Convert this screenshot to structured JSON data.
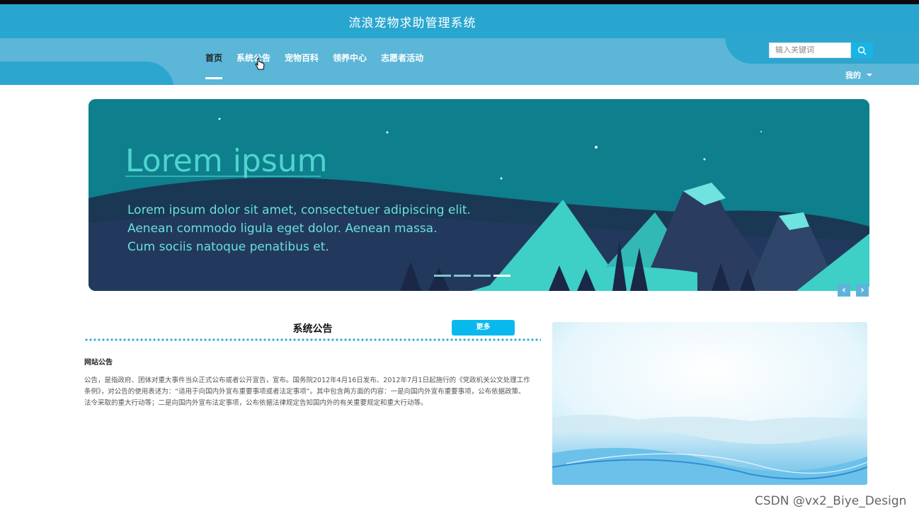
{
  "header": {
    "title": "流浪宠物求助管理系统",
    "search_placeholder": "输入关键词",
    "mine_label": "我的"
  },
  "nav": {
    "items": [
      {
        "label": "首页",
        "active": true
      },
      {
        "label": "系统公告"
      },
      {
        "label": "宠物百科"
      },
      {
        "label": "领养中心"
      },
      {
        "label": "志愿者活动"
      }
    ]
  },
  "banner": {
    "headline": "Lorem ipsum",
    "lines": [
      "Lorem ipsum dolor sit amet, consectetuer adipiscing elit.",
      "Aenean commodo ligula eget dolor. Aenean massa.",
      "Cum sociis natoque penatibus et."
    ],
    "slide_count": 4,
    "active_slide": 4,
    "colors": {
      "bg": "#0e7f8c",
      "mountain": "#3ecfc7",
      "dark": "#1c2b4a"
    }
  },
  "notice": {
    "section_title": "系统公告",
    "more_label": "更多",
    "item_title": "网站公告",
    "item_body": "公告，是指政府、团体对重大事件当众正式公布或者公开宣告，宣布。国务院2012年4月16日发布、2012年7月1日起施行的《党政机关公文处理工作条例》，对公告的使用表述为：“适用于向国内外宣布重要事项或者法定事项”。其中包含两方面的内容：一是向国内外宣布重要事项，公布依据政策、法令采取的重大行动等；二是向国内外宣布法定事项，公布依据法律规定告知国内外的有关重要规定和重大行动等。"
  },
  "watermark": "CSDN @vx2_Biye_Design",
  "theme": {
    "primary": "#29a6cf",
    "accent": "#09b9ee"
  }
}
